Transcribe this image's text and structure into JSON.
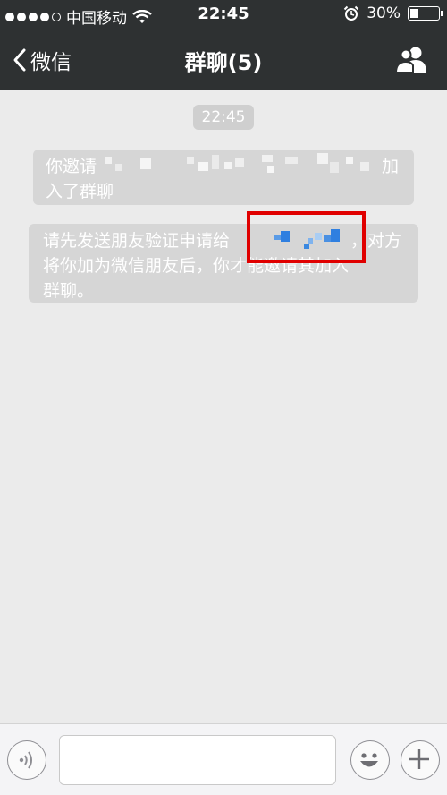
{
  "status_bar": {
    "carrier": "中国移动",
    "time": "22:45",
    "battery": "30%",
    "battery_level": 0.3
  },
  "nav": {
    "back_label": "微信",
    "title": "群聊(5)"
  },
  "chat": {
    "timestamp": "22:45",
    "messages": [
      {
        "line1_start": "你邀请",
        "line1_end": "加",
        "line2": "入了群聊"
      },
      {
        "line1": "请先发送朋友验证申请给",
        "line1_end": "，对方",
        "line2": "将你加为微信朋友后，你才能邀请其加入",
        "line3": "群聊。"
      }
    ]
  },
  "input": {
    "placeholder": ""
  }
}
